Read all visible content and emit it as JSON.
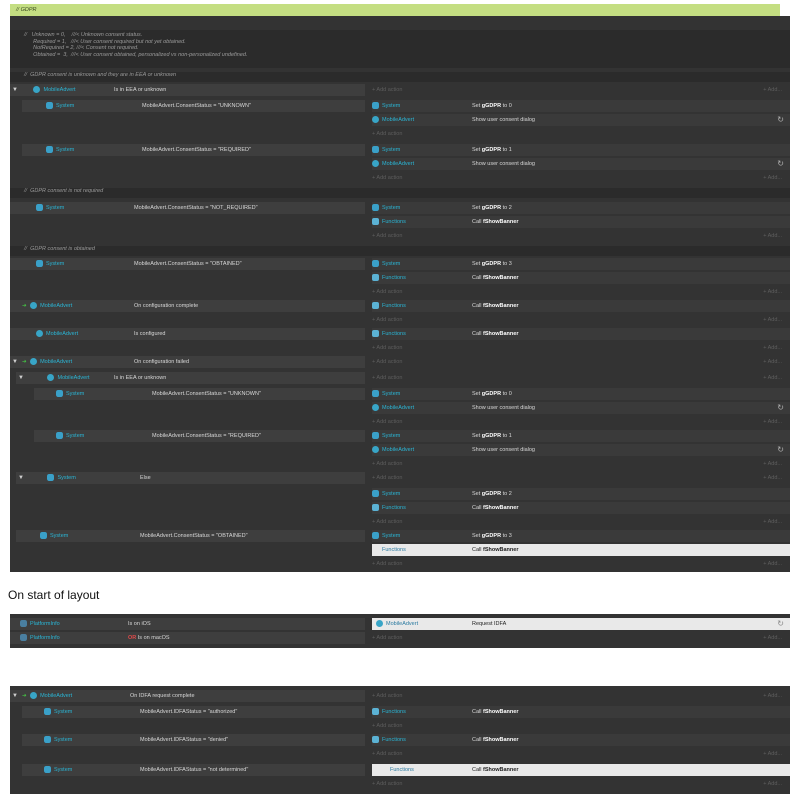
{
  "gdpr_label": "// GDPR",
  "comments": {
    "c1": "//   Unknown = 0,    ///< Unknown consent status.\n      Required = 1,   ///< User consent required but not yet obtained.\n      NotRequired = 2, ///< Consent not required.\n      Obtained =  3,  ///< User consent obtained, personalized vs non-personalized undefined.",
    "c2": "//  GDPR consent is unknown and they are in EEA or unknown",
    "c3": "//  GDPR consent is not required",
    "c4": "//  GDPR consent is obtained"
  },
  "objects": {
    "mobile_advert": "MobileAdvert",
    "system": "System",
    "functions": "Functions",
    "platform_info": "PlatformInfo"
  },
  "conditions": {
    "is_eea": "Is in EEA or unknown",
    "status_unknown": "MobileAdvert.ConsentStatus = \"UNKNOWN\"",
    "status_required": "MobileAdvert.ConsentStatus = \"REQUIRED\"",
    "status_not_required": "MobileAdvert.ConsentStatus = \"NOT_REQUIRED\"",
    "status_obtained": "MobileAdvert.ConsentStatus = \"OBTAINED\"",
    "config_complete": "On configuration complete",
    "is_configured": "Is configured",
    "config_failed": "On configuration failed",
    "else": "Else",
    "is_ios": "Is on iOS",
    "or": "OR",
    "is_macos": "Is on macOS",
    "idfa_complete": "On IDFA request complete",
    "idfa_authorized": "MobileAdvert.IDFAStatus = \"authorized\"",
    "idfa_denied": "MobileAdvert.IDFAStatus = \"denied\"",
    "idfa_not_determined": "MobileAdvert.IDFAStatus = \"not determined\""
  },
  "actions": {
    "set_0_pre": "Set ",
    "set_var": "gGDPR",
    "set_0_post": " to 0",
    "set_1_post": " to 1",
    "set_2_post": " to 2",
    "set_3_post": " to 3",
    "show_dialog": "Show user consent dialog",
    "call_pre": "Call ",
    "call_fn": "fShowBanner",
    "request_idfa": "Request IDFA"
  },
  "add_action": "+ Add action",
  "add_right": "+ Add...",
  "heading": "On start of layout"
}
